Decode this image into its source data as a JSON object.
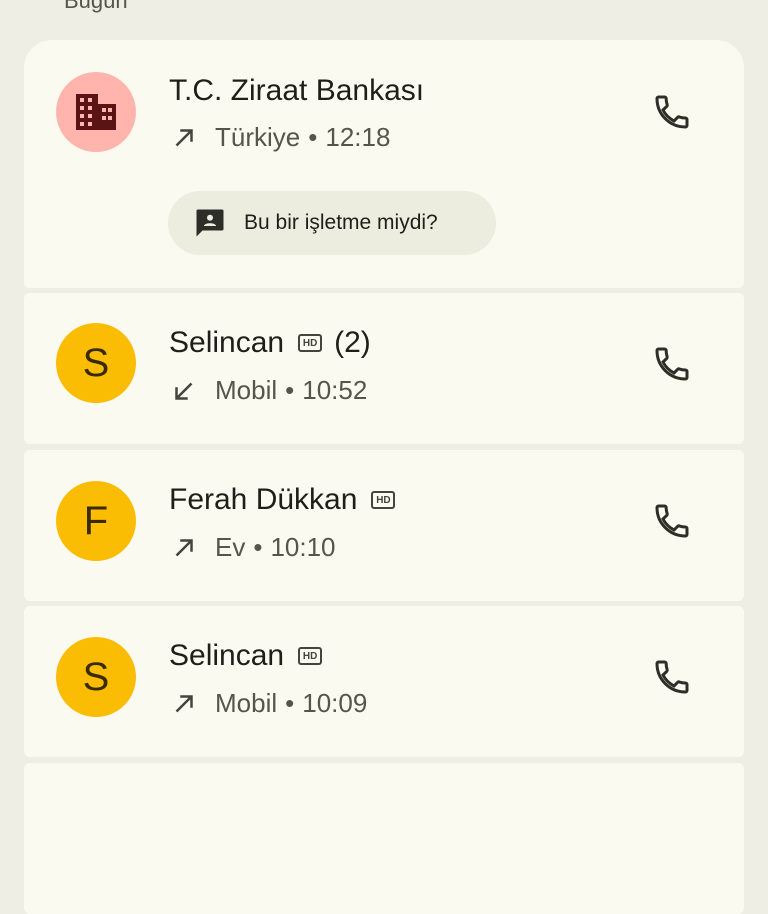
{
  "section": {
    "label": "Bugün"
  },
  "calls": [
    {
      "name": "T.C. Ziraat Bankası",
      "avatar_type": "business-icon",
      "direction": "outgoing",
      "type": "Türkiye",
      "separator": "•",
      "time": "12:18",
      "suggestion_chip": "Bu bir işletme miydi?"
    },
    {
      "name": "Selincan",
      "avatar_letter": "S",
      "hd": "HD",
      "count": "(2)",
      "direction": "incoming",
      "type": "Mobil",
      "separator": "•",
      "time": "10:52"
    },
    {
      "name": "Ferah Dükkan",
      "avatar_letter": "F",
      "hd": "HD",
      "direction": "outgoing",
      "type": "Ev",
      "separator": "•",
      "time": "10:10"
    },
    {
      "name": "Selincan",
      "avatar_letter": "S",
      "hd": "HD",
      "direction": "outgoing",
      "type": "Mobil",
      "separator": "•",
      "time": "10:09"
    }
  ],
  "colors": {
    "background": "#eeeee4",
    "card": "#fafaf0",
    "avatar_business": "#ffb4ae",
    "avatar_contact": "#fbbc04"
  }
}
